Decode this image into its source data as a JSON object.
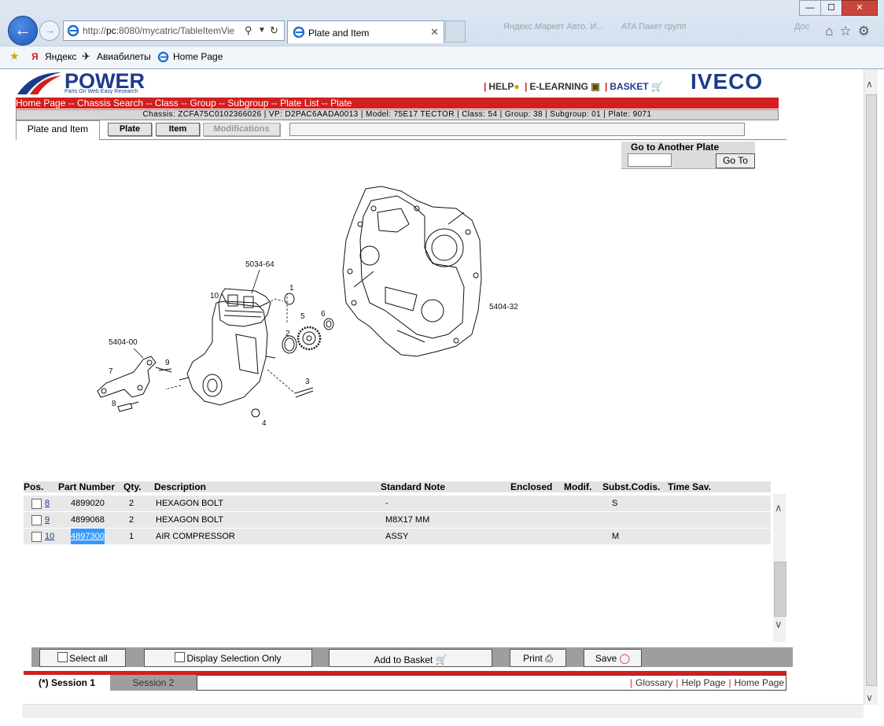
{
  "browser": {
    "url_prefix": "http://",
    "url_host": "pc",
    "url_rest": ":8080/mycatric/TableItemVie",
    "tab_title": "Plate and Item",
    "ghost_tabs": [
      "Яндекс.Маркет Авто. И...",
      "ATA Пакет групп",
      "Дос"
    ],
    "favorites": [
      "Яндекс",
      "Авиабилеты",
      "Home Page"
    ],
    "window_buttons": [
      "—",
      "☐",
      "✕"
    ]
  },
  "header": {
    "logo_word": "POWER",
    "logo_tag": "Parts On Web Easy Research",
    "links": {
      "help": "HELP",
      "elearning": "E-LEARNING",
      "basket": "BASKET"
    },
    "brand": "IVECO",
    "breadcrumb": "Home Page -- Chassis Search -- Class -- Group -- Subgroup -- Plate List -- Plate",
    "chassis_info": "Chassis: ZCFA75C0102366026 | VP: D2PAC6AADA0013 | Model: 75E17 TECTOR | Class: 54 | Group: 38 | Subgroup: 01 | Plate: 9071"
  },
  "tabs": {
    "current": "Plate and Item",
    "plate": "Plate",
    "item": "Item",
    "modifications": "Modifications"
  },
  "goto": {
    "label": "Go to Another Plate",
    "button": "Go To",
    "value": ""
  },
  "drawing": {
    "labels": [
      "5034-64",
      "10",
      "1",
      "5",
      "6",
      "2",
      "5404-00",
      "9",
      "7",
      "8",
      "3",
      "4",
      "5404-32"
    ]
  },
  "table": {
    "headers": {
      "pos": "Pos.",
      "part_number": "Part Number",
      "qty": "Qty.",
      "description": "Description",
      "standard_note": "Standard Note",
      "enclosed": "Enclosed",
      "modif": "Modif.",
      "subst": "Subst.Codis.",
      "time": "Time Sav."
    },
    "rows": [
      {
        "pos": "8",
        "part_number": "4899020",
        "qty": "2",
        "description": "HEXAGON BOLT",
        "note": "-",
        "subst": "S"
      },
      {
        "pos": "9",
        "part_number": "4899068",
        "qty": "2",
        "description": "HEXAGON BOLT",
        "note": "M8X17 MM",
        "subst": ""
      },
      {
        "pos": "10",
        "part_number": "4897300",
        "qty": "1",
        "description": "AIR COMPRESSOR",
        "note": "ASSY",
        "subst": "M"
      }
    ]
  },
  "toolbar": {
    "select_all": "Select all",
    "display_selection": "Display Selection Only",
    "add_to_basket": "Add to Basket",
    "print": "Print",
    "save": "Save"
  },
  "sessions": {
    "session1": "(*) Session 1",
    "session2": "Session 2"
  },
  "footer_links": {
    "glossary": "Glossary",
    "help": "Help Page",
    "home": "Home Page"
  }
}
